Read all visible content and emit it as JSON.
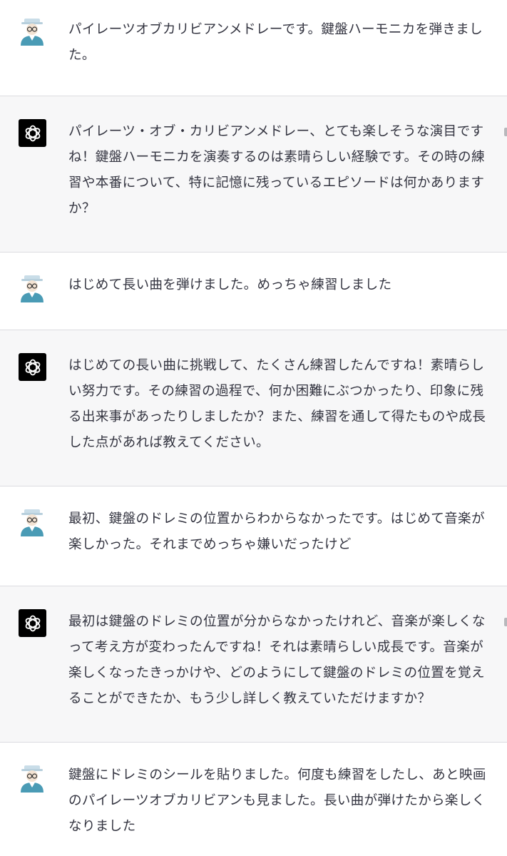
{
  "conversation": {
    "messages": [
      {
        "role": "user",
        "avatar": "user-avatar-icon",
        "text": "パイレーツオブカリビアンメドレーです。鍵盤ハーモニカを弾きました。"
      },
      {
        "role": "assistant",
        "avatar": "chatgpt-logo-icon",
        "text": "パイレーツ・オブ・カリビアンメドレー、とても楽しそうな演目ですね！鍵盤ハーモニカを演奏するのは素晴らしい経験です。その時の練習や本番について、特に記憶に残っているエピソードは何かありますか？"
      },
      {
        "role": "user",
        "avatar": "user-avatar-icon",
        "text": "はじめて長い曲を弾けました。めっちゃ練習しました"
      },
      {
        "role": "assistant",
        "avatar": "chatgpt-logo-icon",
        "text": "はじめての長い曲に挑戦して、たくさん練習したんですね！素晴らしい努力です。その練習の過程で、何か困難にぶつかったり、印象に残る出来事があったりしましたか？また、練習を通して得たものや成長した点があれば教えてください。"
      },
      {
        "role": "user",
        "avatar": "user-avatar-icon",
        "text": "最初、鍵盤のドレミの位置からわからなかったです。はじめて音楽が楽しかった。それまでめっちゃ嫌いだったけど"
      },
      {
        "role": "assistant",
        "avatar": "chatgpt-logo-icon",
        "text": "最初は鍵盤のドレミの位置が分からなかったけれど、音楽が楽しくなって考え方が変わったんですね！それは素晴らしい成長です。音楽が楽しくなったきっかけや、どのようにして鍵盤のドレミの位置を覚えることができたか、もう少し詳しく教えていただけますか？"
      },
      {
        "role": "user",
        "avatar": "user-avatar-icon",
        "text": "鍵盤にドレミのシールを貼りました。何度も練習をしたし、あと映画のパイレーツオブカリビアンも見ました。長い曲が弾けたから楽しくなりました"
      }
    ]
  },
  "colors": {
    "assistant_bg": "#f7f7f8",
    "user_bg": "#ffffff",
    "divider": "#dcdce0",
    "text": "#343541",
    "bot_avatar_bg": "#000000",
    "user_avatar_hat": "#c9dde8",
    "user_avatar_body": "#4a9bb5"
  }
}
